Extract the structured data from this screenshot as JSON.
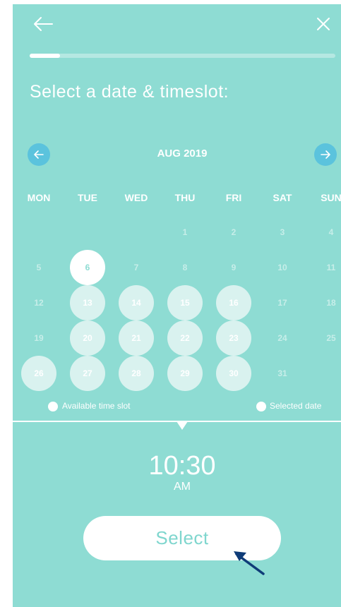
{
  "nav": {
    "back_icon": "arrow-left-icon",
    "close_icon": "close-icon"
  },
  "progress": {
    "value": 0.1
  },
  "title": "Select a date & timeslot:",
  "calendar": {
    "month_label": "AUG 2019",
    "prev_icon": "arrow-left-icon",
    "next_icon": "arrow-right-icon",
    "weekdays": [
      "MON",
      "TUE",
      "WED",
      "THU",
      "FRI",
      "SAT",
      "SUN"
    ],
    "weeks": [
      [
        null,
        null,
        null,
        {
          "label": "1",
          "state": "unavailable"
        },
        {
          "label": "2",
          "state": "unavailable"
        },
        {
          "label": "3",
          "state": "unavailable"
        },
        {
          "label": "4",
          "state": "unavailable"
        }
      ],
      [
        {
          "label": "5",
          "state": "unavailable"
        },
        {
          "label": "6",
          "state": "selected"
        },
        {
          "label": "7",
          "state": "unavailable"
        },
        {
          "label": "8",
          "state": "unavailable"
        },
        {
          "label": "9",
          "state": "unavailable"
        },
        {
          "label": "10",
          "state": "unavailable"
        },
        {
          "label": "11",
          "state": "unavailable"
        }
      ],
      [
        {
          "label": "12",
          "state": "unavailable"
        },
        {
          "label": "13",
          "state": "available"
        },
        {
          "label": "14",
          "state": "available"
        },
        {
          "label": "15",
          "state": "available"
        },
        {
          "label": "16",
          "state": "available"
        },
        {
          "label": "17",
          "state": "unavailable"
        },
        {
          "label": "18",
          "state": "unavailable"
        }
      ],
      [
        {
          "label": "19",
          "state": "unavailable"
        },
        {
          "label": "20",
          "state": "available"
        },
        {
          "label": "21",
          "state": "available"
        },
        {
          "label": "22",
          "state": "available"
        },
        {
          "label": "23",
          "state": "available"
        },
        {
          "label": "24",
          "state": "unavailable"
        },
        {
          "label": "25",
          "state": "unavailable"
        }
      ],
      [
        {
          "label": "26",
          "state": "available"
        },
        {
          "label": "27",
          "state": "available"
        },
        {
          "label": "28",
          "state": "available"
        },
        {
          "label": "29",
          "state": "available"
        },
        {
          "label": "30",
          "state": "available"
        },
        {
          "label": "31",
          "state": "unavailable"
        },
        null
      ]
    ]
  },
  "legend": {
    "available": "Available time slot",
    "selected": "Selected date"
  },
  "time": {
    "value": "10:30",
    "ampm": "AM"
  },
  "actions": {
    "select_label": "Select"
  },
  "colors": {
    "background": "#8edcd3",
    "available_fill": "#d9f2ef",
    "nav_button": "#5bc3dd",
    "cursor": "#0f3c78"
  }
}
